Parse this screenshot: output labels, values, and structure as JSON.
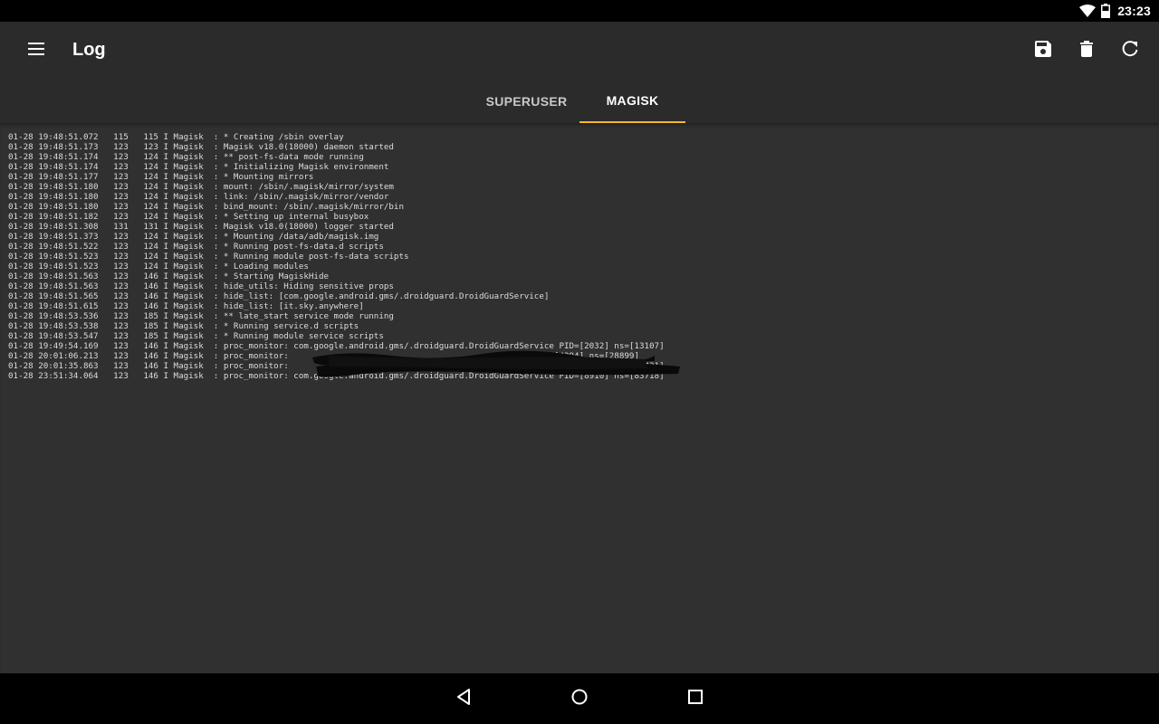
{
  "status_bar": {
    "time": "23:23",
    "icons": [
      "wifi-icon",
      "battery-icon"
    ]
  },
  "app_bar": {
    "title": "Log",
    "icons": [
      "menu-icon",
      "save-icon",
      "delete-icon",
      "refresh-icon"
    ]
  },
  "tabs": [
    {
      "label": "SUPERUSER",
      "active": false
    },
    {
      "label": "MAGISK",
      "active": true
    }
  ],
  "colors": {
    "accent": "#f6b92b",
    "background": "#303030",
    "app_bar": "#2b2b2b",
    "log_text": "#dcdcdc"
  },
  "log": {
    "lines": [
      "01-28 19:48:51.072   115   115 I Magisk  : * Creating /sbin overlay",
      "01-28 19:48:51.173   123   123 I Magisk  : Magisk v18.0(18000) daemon started",
      "01-28 19:48:51.174   123   124 I Magisk  : ** post-fs-data mode running",
      "01-28 19:48:51.174   123   124 I Magisk  : * Initializing Magisk environment",
      "01-28 19:48:51.177   123   124 I Magisk  : * Mounting mirrors",
      "01-28 19:48:51.180   123   124 I Magisk  : mount: /sbin/.magisk/mirror/system",
      "01-28 19:48:51.180   123   124 I Magisk  : link: /sbin/.magisk/mirror/vendor",
      "01-28 19:48:51.180   123   124 I Magisk  : bind_mount: /sbin/.magisk/mirror/bin",
      "01-28 19:48:51.182   123   124 I Magisk  : * Setting up internal busybox",
      "01-28 19:48:51.308   131   131 I Magisk  : Magisk v18.0(18000) logger started",
      "01-28 19:48:51.373   123   124 I Magisk  : * Mounting /data/adb/magisk.img",
      "01-28 19:48:51.522   123   124 I Magisk  : * Running post-fs-data.d scripts",
      "01-28 19:48:51.523   123   124 I Magisk  : * Running module post-fs-data scripts",
      "01-28 19:48:51.523   123   124 I Magisk  : * Loading modules",
      "01-28 19:48:51.563   123   146 I Magisk  : * Starting MagiskHide",
      "01-28 19:48:51.563   123   146 I Magisk  : hide_utils: Hiding sensitive props",
      "01-28 19:48:51.565   123   146 I Magisk  : hide_list: [com.google.android.gms/.droidguard.DroidGuardService]",
      "01-28 19:48:51.615   123   146 I Magisk  : hide_list: [it.sky.anywhere]",
      "01-28 19:48:53.536   123   185 I Magisk  : ** late_start service mode running",
      "01-28 19:48:53.538   123   185 I Magisk  : * Running service.d scripts",
      "01-28 19:48:53.547   123   185 I Magisk  : * Running module service scripts",
      "01-28 19:49:54.169   123   146 I Magisk  : proc_monitor: com.google.android.gms/.droidguard.DroidGuardService PID=[2032] ns=[13107]",
      "01-28 20:01:06.213   123   146 I Magisk  : proc_monitor:                                                 PID=[4394] ns=[28899]",
      "01-28 20:01:35.863   123   146 I Magisk  : proc_monitor:                                                      PID=[4632] ns=[29431]",
      "01-28 23:51:34.064   123   146 I Magisk  : proc_monitor: com.google.android.gms/.droidguard.DroidGuardService PID=[8910] ns=[83718]"
    ]
  },
  "nav_bar": {
    "icons": [
      "back-icon",
      "home-icon",
      "recents-icon"
    ]
  }
}
